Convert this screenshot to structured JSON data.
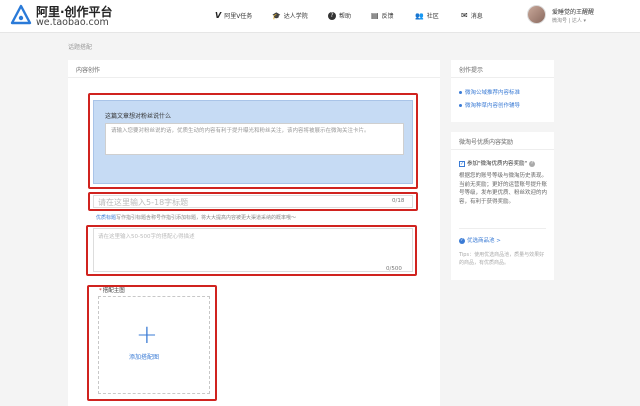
{
  "header": {
    "logo_title": "阿里·创作平台",
    "logo_url": "we.taobao.com",
    "nav": [
      {
        "icon": "V",
        "label": "阿里V任务"
      },
      {
        "icon": "🎓",
        "label": "达人学院"
      },
      {
        "icon": "?",
        "label": "帮助"
      },
      {
        "icon": "▤",
        "label": "反馈"
      },
      {
        "icon": "👥",
        "label": "社区"
      },
      {
        "icon": "✉",
        "label": "消息"
      }
    ],
    "user_name": "爱睡觉的王醒醒",
    "user_role": "微淘号 | 达人 ▾"
  },
  "breadcrumb": "话题搭配",
  "main": {
    "title": "内容创作",
    "prompt_label": "这篇文章想对粉丝说什么",
    "prompt_placeholder": "请输入您要对粉丝说的话，优质生动的内容有利于提升曝光和粉丝关注，该内容将被展示在微淘关注卡片。",
    "title_placeholder": "请在这里输入5-18字标题",
    "title_counter": "0/18",
    "hint_link": "优质标题",
    "hint_text": "写作指引标题含称号作指引添加标题，将大大提高内容被更大渠道采纳的概率哦～",
    "desc_placeholder": "请在这里输入50-500字的搭配心得描述",
    "desc_counter": "0/500",
    "section_required": "*",
    "section_label": "搭配主图",
    "upload_plus": "+",
    "upload_label": "添加搭配图"
  },
  "side_tips": {
    "title": "创作提示",
    "items": [
      "微淘公域推荐内容标准",
      "微淘种草内容创作辅导"
    ]
  },
  "side_award": {
    "title": "微淘号优质内容奖励",
    "check_mark": "✓",
    "check_label": "参加\"微淘优质内容奖励\"",
    "question_mark": "?",
    "description": "根据您的账号等级与微淘历史表现。当前无奖励；更好的运营账号提升账号等级，发布更优质、粉丝欢迎的内容，有利于获得奖励。",
    "pick_mark": "✓",
    "pick_label": "优选商品池 >",
    "small_tip": "Tips：使用优选商品池，质量与效果好的商品，有优质商品。"
  }
}
